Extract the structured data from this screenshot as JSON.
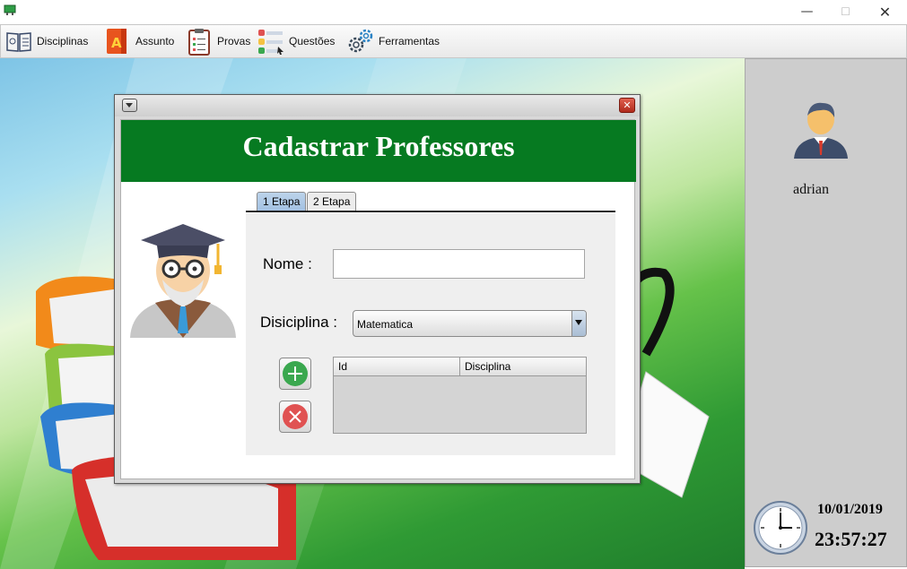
{
  "window": {
    "min_glyph": "—",
    "max_glyph": "☐",
    "close_glyph": "✕"
  },
  "menubar": {
    "items": [
      {
        "label": "Disciplinas",
        "icon": "book-icon"
      },
      {
        "label": "Assunto",
        "icon": "letter-a-book-icon"
      },
      {
        "label": "Provas",
        "icon": "clipboard-icon"
      },
      {
        "label": "Questões",
        "icon": "question-list-icon"
      },
      {
        "label": "Ferramentas",
        "icon": "gears-icon"
      }
    ]
  },
  "dialog": {
    "title": "Cadastrar Professores",
    "tabs": [
      {
        "label": "1 Etapa",
        "active": true
      },
      {
        "label": "2 Etapa",
        "active": false
      }
    ],
    "nome_label": "Nome :",
    "nome_value": "",
    "disciplina_label": "Disiciplina :",
    "disciplina_value": "Matematica",
    "table": {
      "columns": [
        "Id",
        "Disciplina"
      ],
      "rows": []
    },
    "close_glyph": "✕"
  },
  "sidebar": {
    "user_name": "adrian",
    "date": "10/01/2019",
    "time": "23:57:27"
  },
  "colors": {
    "header_green": "#067a21",
    "add_button": "#3aa84f",
    "remove_button": "#e05252"
  }
}
